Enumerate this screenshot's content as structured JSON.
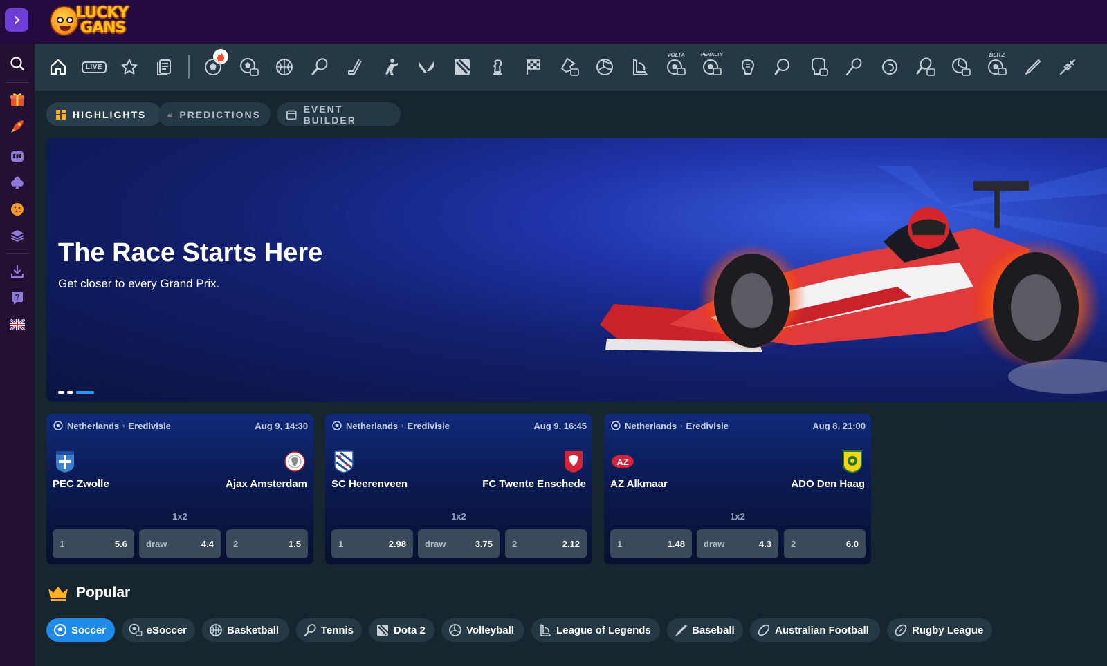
{
  "brand": {
    "logo_line1": "LUCKY",
    "logo_line2": "GANS"
  },
  "header": {
    "expand_icon": "chevron-right-icon",
    "accent_color": "#6d3ed6",
    "background": "#240a3e"
  },
  "sidebar": {
    "items": [
      {
        "icon": "search-icon"
      },
      {
        "icon": "gift-icon"
      },
      {
        "icon": "rocket-icon"
      },
      {
        "icon": "slot-machine-icon"
      },
      {
        "icon": "club-suit-icon"
      },
      {
        "icon": "baseball-cookie-icon"
      },
      {
        "icon": "layers-icon"
      },
      {
        "icon": "download-icon"
      },
      {
        "icon": "help-icon"
      },
      {
        "icon": "uk-flag-icon"
      }
    ]
  },
  "sports_nav": {
    "live_label": "LIVE",
    "items": [
      "home-icon",
      "live-icon",
      "favorites-star-icon",
      "betslip-icon",
      "hot-soccer-icon",
      "esoccer-icon",
      "basketball-icon",
      "tennis-icon",
      "hockey-icon",
      "counter-strike-icon",
      "valorant-icon",
      "dota2-icon",
      "chess-icon",
      "racing-flag-icon",
      "ebasketball-icon",
      "volleyball-icon",
      "league-of-legends-icon",
      "volta-icon",
      "penalty-icon",
      "mma-icon",
      "table-tennis-icon",
      "boxing-icon",
      "badminton-icon",
      "handball-icon",
      "etennis-icon",
      "evolleyball-icon",
      "blitz-icon",
      "baseball-icon",
      "darts-icon"
    ],
    "volta_label": "VOLTA",
    "penalty_label": "PENALTY",
    "blitz_label": "BLITZ"
  },
  "subtabs": [
    {
      "label": "HIGHLIGHTS",
      "icon": "grid-icon",
      "active": true
    },
    {
      "label": "PREDICTIONS",
      "icon": "chart-icon",
      "active": false
    },
    {
      "label": "EVENT BUILDER",
      "icon": "calendar-icon",
      "active": false
    }
  ],
  "banner": {
    "title": "The Race Starts Here",
    "subtitle": "Get closer to every Grand Prix.",
    "slides": 3,
    "active_slide": 3
  },
  "matches": [
    {
      "country": "Netherlands",
      "league": "Eredivisie",
      "date": "Aug 9, 14:30",
      "home": "PEC Zwolle",
      "away": "Ajax Amsterdam",
      "market": "1x2",
      "odds": [
        {
          "label": "1",
          "value": "5.6"
        },
        {
          "label": "draw",
          "value": "4.4"
        },
        {
          "label": "2",
          "value": "1.5"
        }
      ]
    },
    {
      "country": "Netherlands",
      "league": "Eredivisie",
      "date": "Aug 9, 16:45",
      "home": "SC Heerenveen",
      "away": "FC Twente Enschede",
      "market": "1x2",
      "odds": [
        {
          "label": "1",
          "value": "2.98"
        },
        {
          "label": "draw",
          "value": "3.75"
        },
        {
          "label": "2",
          "value": "2.12"
        }
      ]
    },
    {
      "country": "Netherlands",
      "league": "Eredivisie",
      "date": "Aug 8, 21:00",
      "home": "AZ Alkmaar",
      "away": "ADO Den Haag",
      "market": "1x2",
      "odds": [
        {
          "label": "1",
          "value": "1.48"
        },
        {
          "label": "draw",
          "value": "4.3"
        },
        {
          "label": "2",
          "value": "6.0"
        }
      ]
    }
  ],
  "popular": {
    "title": "Popular",
    "pills": [
      {
        "label": "Soccer",
        "icon": "soccer-icon",
        "active": true
      },
      {
        "label": "eSoccer",
        "icon": "esoccer-icon",
        "active": false
      },
      {
        "label": "Basketball",
        "icon": "basketball-icon",
        "active": false
      },
      {
        "label": "Tennis",
        "icon": "tennis-icon",
        "active": false
      },
      {
        "label": "Dota 2",
        "icon": "dota2-icon",
        "active": false
      },
      {
        "label": "Volleyball",
        "icon": "volleyball-icon",
        "active": false
      },
      {
        "label": "League of Legends",
        "icon": "league-of-legends-icon",
        "active": false
      },
      {
        "label": "Baseball",
        "icon": "baseball-icon",
        "active": false
      },
      {
        "label": "Australian Football",
        "icon": "australian-football-icon",
        "active": false
      },
      {
        "label": "Rugby League",
        "icon": "rugby-icon",
        "active": false
      }
    ]
  }
}
